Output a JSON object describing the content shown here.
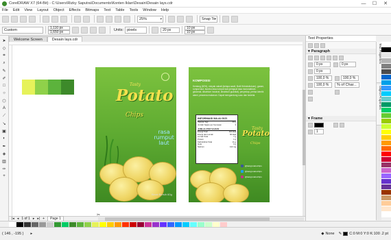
{
  "window": {
    "title": "CorelDRAW X7 (64-Bit) - C:\\Users\\Rizky Saputra\\Documents\\Konten Iklan\\Desain\\Desain lays.cdr",
    "minimize": "—",
    "maximize": "☐",
    "close": "✕"
  },
  "menu": [
    "File",
    "Edit",
    "View",
    "Layout",
    "Object",
    "Effects",
    "Bitmaps",
    "Text",
    "Table",
    "Tools",
    "Window",
    "Help"
  ],
  "toolbar": {
    "zoom": "25%",
    "snap_to": "Snap To",
    "zoom_caret": "▾",
    "snap_caret": "▾"
  },
  "propbar": {
    "page_preset": "Custom",
    "width": "1,110 px",
    "height": "1,650 px",
    "units_label": "Units:",
    "units": "pixels",
    "nudge": "20 px",
    "dup_x": "10 px",
    "dup_y": "10 px"
  },
  "tabs": [
    {
      "label": "Welcome Screen",
      "active": false
    },
    {
      "label": "Desain lays.cdr",
      "active": true
    }
  ],
  "swatches": [
    "#e6f25a",
    "#8fd14a",
    "#5cb33c",
    "#3d8a2a"
  ],
  "front": {
    "tasty": "Tasty",
    "brand": "Potato",
    "chips": "Chips",
    "flavor": "rasa rumput laut",
    "netto": "Berat Bersih 60g"
  },
  "back": {
    "komposisi_title": "KOMPOSISI",
    "komposisi_text": "Kentang (60%), minyak nabati (kelapa sawit, Butil Hidroksitoluen), garam, rumput laut, bumbu rasa rumput laut (penguat rasa mononatrium glutamat, dinatrium inosinat, dinatrium guanilat), penyedap, perisa identik alami, pewarna makanan. Dapat mengandung susu dan kedelai.",
    "nutrition_title": "INFORMASI NILAI GIZI",
    "nutrition_rows": [
      {
        "k": "Takaran Saji",
        "v": "20 g"
      },
      {
        "k": "Jumlah Sajian per Kemasan",
        "v": "3"
      }
    ],
    "nutrition_sub": "JUMLAH PER SAJIAN",
    "nutrition_rows2": [
      {
        "k": "Energi Total",
        "v": "110 kkal"
      },
      {
        "k": "Energi dari Lemak",
        "v": "60 kkal"
      },
      {
        "k": "Lemak Total",
        "v": "7 g"
      },
      {
        "k": "Protein",
        "v": "1 g"
      },
      {
        "k": "Karbohidrat Total",
        "v": "11 g"
      },
      {
        "k": "Gula",
        "v": "0 g"
      },
      {
        "k": "Natrium",
        "v": "110 mg"
      }
    ],
    "brand": "Potato",
    "tasty": "Tasty",
    "chips": "Chips",
    "social": [
      {
        "label": "@tastypotatochips",
        "color": "#3b5998"
      },
      {
        "label": "@tastypotatochips",
        "color": "#1da1f2"
      },
      {
        "label": "@tastypotatochips",
        "color": "#c13584"
      }
    ]
  },
  "pagebar": {
    "page_of": "1 of 1",
    "page_tab": "Page 1"
  },
  "props": {
    "header": "Text Properties",
    "paragraph": "Paragraph",
    "indent1": "0 px",
    "indent2": "0 px",
    "indent3": "0 px",
    "spacing1": "100,0 %",
    "spacing2": "100,0 %",
    "spacing3": "100,0 %",
    "spacing_mode": "% of Char...",
    "frame": "Frame",
    "frame_cols": "1"
  },
  "docker_tabs": [
    "Text Properties",
    "Object Properties"
  ],
  "palette_right": [
    "#ffffff",
    "#000000",
    "#e6e6e6",
    "#b3b3b3",
    "#808080",
    "#4d4d4d",
    "#0066cc",
    "#00a0e9",
    "#3399ff",
    "#00ccff",
    "#66cccc",
    "#009966",
    "#00cc66",
    "#66cc33",
    "#99cc00",
    "#ccff33",
    "#ffff00",
    "#ffcc00",
    "#ff9900",
    "#ff6600",
    "#ff0000",
    "#cc0033",
    "#993366",
    "#cc66cc",
    "#9966ff",
    "#6633cc",
    "#663399",
    "#993300",
    "#cc9966",
    "#ffcc99",
    "#ffe6cc",
    "#ffffff"
  ],
  "palette_bottom": [
    "#ffffff",
    "#000000",
    "#333333",
    "#666666",
    "#999999",
    "#cccccc",
    "#339933",
    "#00cc66",
    "#3d8a2a",
    "#5cb33c",
    "#8fd14a",
    "#e6f25a",
    "#ffff00",
    "#ffcc00",
    "#ff9900",
    "#ff3300",
    "#cc0000",
    "#990033",
    "#cc3399",
    "#9933cc",
    "#6633ff",
    "#3366ff",
    "#0099ff",
    "#00ccff",
    "#66ffff",
    "#99ffcc",
    "#ccffcc",
    "#ffffcc",
    "#ffcccc"
  ],
  "status": {
    "cursor": "( 146 , -195 )",
    "fill": "None",
    "outline": "C:0 M:0 Y:0 K:100  .2 pt"
  }
}
